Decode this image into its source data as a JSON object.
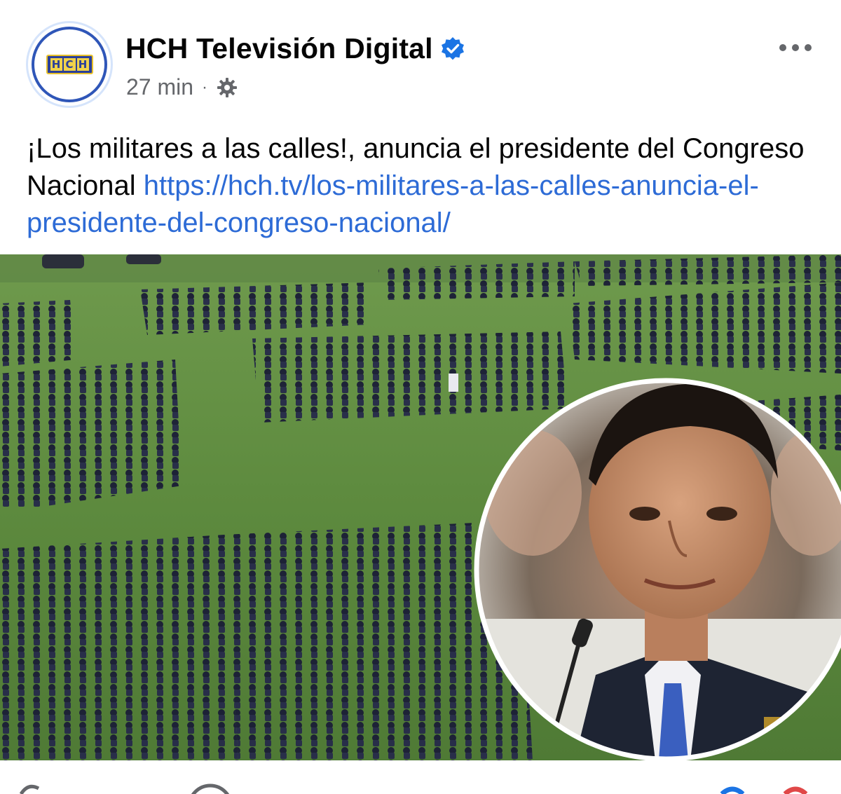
{
  "post": {
    "page_name": "HCH Televisión Digital",
    "logo_text": "HCH",
    "timestamp": "27 min",
    "separator": "·",
    "audience_icon": "globe-gear-icon",
    "caption_text": "¡Los militares a las calles!, anuncia el presidente del Congreso Nacional ",
    "caption_link": "https://hch.tv/los-militares-a-las-calles-anuncia-el-presidente-del-congreso-nacional/"
  },
  "icons": {
    "verified": "verified-badge-icon",
    "more": "more-options-icon"
  },
  "colors": {
    "link": "#2d6bd6",
    "verified": "#1b74e4",
    "meta_text": "#65676b",
    "logo_blue": "#2a3f9a",
    "logo_yellow": "#f1d24a"
  }
}
